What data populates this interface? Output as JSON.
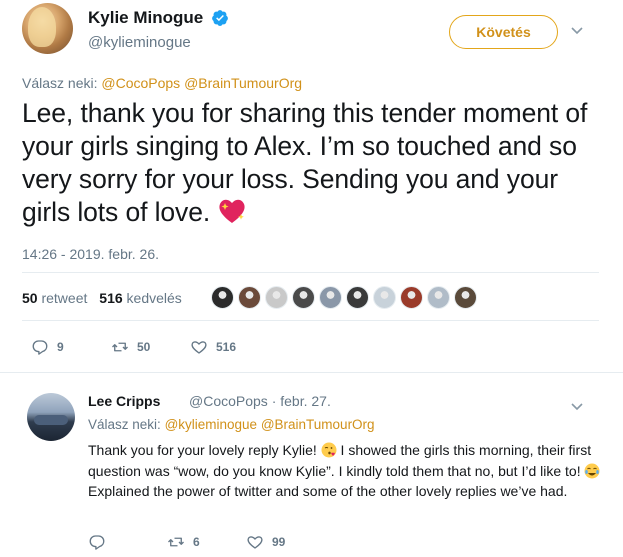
{
  "main_tweet": {
    "author_name": "Kylie Minogue",
    "handle": "@kylieminogue",
    "follow_label": "Követés",
    "reply_to_label": "Válasz neki:",
    "reply_mentions": [
      "@CocoPops",
      "@BrainTumourOrg"
    ],
    "text": "Lee, thank you for sharing this tender moment of your girls singing to Alex. I’m so touched and so very sorry for your loss. Sending you and your girls lots of love.",
    "timestamp": "14:26 - 2019. febr. 26.",
    "retweets_count": "50",
    "retweets_label": "retweet",
    "likes_count": "516",
    "likes_label": "kedvelés",
    "likers": [
      "#2b2b2b",
      "#6b4a3a",
      "#c9c9c9",
      "#4a4a4a",
      "#8a97a8",
      "#3a3a3a",
      "#c8d2da",
      "#9a3b2a",
      "#b0bcc8",
      "#5a4a3a"
    ],
    "actions": {
      "replies": "9",
      "retweets": "50",
      "likes": "516"
    }
  },
  "reply_tweet": {
    "author_name": "Lee Cripps",
    "handle_and_date": "@CocoPops · febr. 27.",
    "reply_to_label": "Válasz neki:",
    "reply_mentions": [
      "@kylieminogue",
      "@BrainTumourOrg"
    ],
    "text_part1": "Thank you for your lovely reply Kylie! ",
    "text_part2": " I showed the girls this morning, their first question was “wow, do you know Kylie”. I kindly told them that no, but I’d like to! ",
    "text_part3": " Explained the power of twitter and some of the other lovely replies we’ve had.",
    "actions": {
      "retweets": "6",
      "likes": "99"
    }
  },
  "colors": {
    "accent": "#d1911a",
    "muted": "#657786",
    "verified": "#1da1f2",
    "heart": "#e0245e"
  }
}
